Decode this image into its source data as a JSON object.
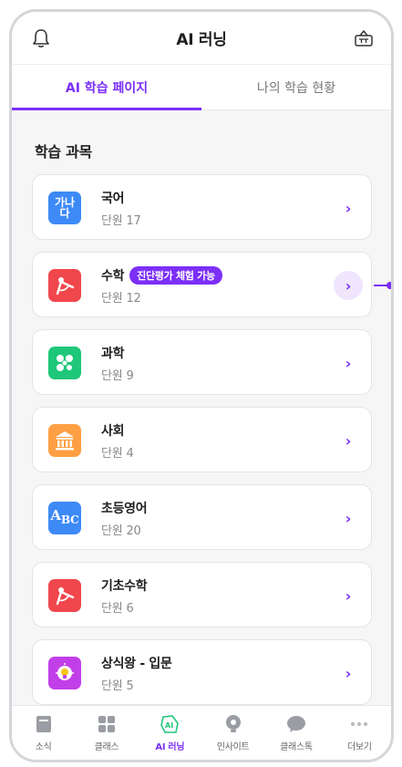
{
  "header": {
    "title": "AI 러닝",
    "left_icon": "bell-icon",
    "right_icon": "shopping-basket-icon"
  },
  "tabs": [
    {
      "label": "AI 학습 페이지",
      "active": true
    },
    {
      "label": "나의 학습 현황",
      "active": false
    }
  ],
  "section_title": "학습 과목",
  "subjects": [
    {
      "name": "국어",
      "units": "단원 17",
      "icon": "korean-letters-icon",
      "icon_color": "#3d8af7"
    },
    {
      "name": "수학",
      "units": "단원 12",
      "icon": "compass-icon",
      "icon_color": "#f0474d",
      "badge": "진단평가 체험 가능"
    },
    {
      "name": "과학",
      "units": "단원 9",
      "icon": "molecule-icon",
      "icon_color": "#1ec779"
    },
    {
      "name": "사회",
      "units": "단원 4",
      "icon": "building-icon",
      "icon_color": "#ff9f43"
    },
    {
      "name": "초등영어",
      "units": "단원 20",
      "icon": "abc-icon",
      "icon_color": "#3d8af7"
    },
    {
      "name": "기초수학",
      "units": "단원 6",
      "icon": "compass-icon",
      "icon_color": "#f0474d"
    },
    {
      "name": "상식왕 - 입문",
      "units": "단원 5",
      "icon": "lightbulb-icon",
      "icon_color": "#c13fe8"
    }
  ],
  "bottom_nav": [
    {
      "label": "소식",
      "icon": "news-icon",
      "active": false
    },
    {
      "label": "클래스",
      "icon": "grid-icon",
      "active": false
    },
    {
      "label": "AI 러닝",
      "icon": "ai-learning-icon",
      "active": true
    },
    {
      "label": "인사이트",
      "icon": "insight-icon",
      "active": false
    },
    {
      "label": "클래스톡",
      "icon": "chat-bubble-icon",
      "active": false
    },
    {
      "label": "더보기",
      "icon": "more-icon",
      "active": false
    }
  ],
  "icon_glyphs": {
    "korean_top": "가나",
    "korean_bottom": "다",
    "abc_a": "A",
    "abc_b": "B",
    "abc_c": "C"
  },
  "colors": {
    "accent": "#7b2ff7",
    "accent_light": "#efe6fd"
  }
}
